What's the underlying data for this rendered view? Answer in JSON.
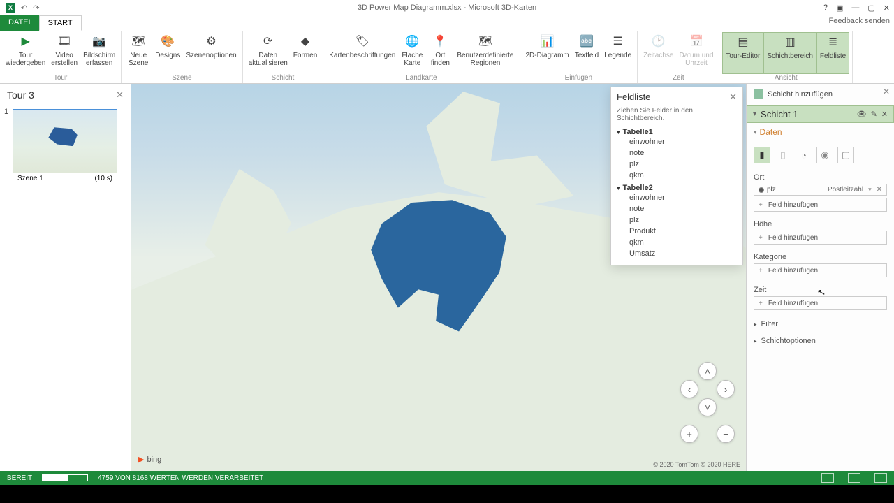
{
  "titlebar": {
    "title": "3D Power Map Diagramm.xlsx - Microsoft 3D-Karten"
  },
  "feedback": "Feedback senden",
  "tabs": {
    "file": "DATEI",
    "start": "START"
  },
  "ribbon": {
    "tour": {
      "label": "Tour",
      "play": "Tour\nwiedergeben",
      "video": "Video\nerstellen",
      "screen": "Bildschirm\nerfassen"
    },
    "scene": {
      "label": "Szene",
      "new": "Neue\nSzene",
      "designs": "Designs",
      "options": "Szenenoptionen"
    },
    "layer": {
      "label": "Schicht",
      "refresh": "Daten\naktualisieren",
      "shapes": "Formen"
    },
    "map": {
      "label": "Landkarte",
      "labels": "Kartenbeschriftungen",
      "flat": "Flache\nKarte",
      "find": "Ort\nfinden",
      "custom": "Benutzerdefinierte\nRegionen"
    },
    "insert": {
      "label": "Einfügen",
      "chart2d": "2D-Diagramm",
      "textfield": "Textfeld",
      "legend": "Legende"
    },
    "time": {
      "label": "Zeit",
      "timeline": "Zeitachse",
      "datetime": "Datum und\nUhrzeit"
    },
    "view": {
      "label": "Ansicht",
      "toured": "Tour-Editor",
      "layerarea": "Schichtbereich",
      "fieldlist": "Feldliste"
    }
  },
  "tour": {
    "title": "Tour 3",
    "scene_num": "1",
    "scene_name": "Szene 1",
    "scene_dur": "(10 s)"
  },
  "map": {
    "bing": "bing",
    "copyright": "© 2020 TomTom © 2020 HERE"
  },
  "fieldlist": {
    "title": "Feldliste",
    "hint": "Ziehen Sie Felder in den Schichtbereich.",
    "tables": [
      {
        "name": "Tabelle1",
        "fields": [
          "einwohner",
          "note",
          "plz",
          "qkm"
        ]
      },
      {
        "name": "Tabelle2",
        "fields": [
          "einwohner",
          "note",
          "plz",
          "Produkt",
          "qkm",
          "Umsatz"
        ]
      }
    ]
  },
  "layerpane": {
    "add": "Schicht hinzufügen",
    "layer_name": "Schicht 1",
    "data_section": "Daten",
    "ort": {
      "label": "Ort",
      "field": "plz",
      "type": "Postleitzahl",
      "add": "Feld hinzufügen"
    },
    "hoehe": {
      "label": "Höhe",
      "add": "Feld hinzufügen"
    },
    "kategorie": {
      "label": "Kategorie",
      "add": "Feld hinzufügen"
    },
    "zeit": {
      "label": "Zeit",
      "add": "Feld hinzufügen"
    },
    "filter": "Filter",
    "options": "Schichtoptionen"
  },
  "status": {
    "ready": "BEREIT",
    "progress": "4759 VON 8168 WERTEN WERDEN VERARBEITET"
  }
}
